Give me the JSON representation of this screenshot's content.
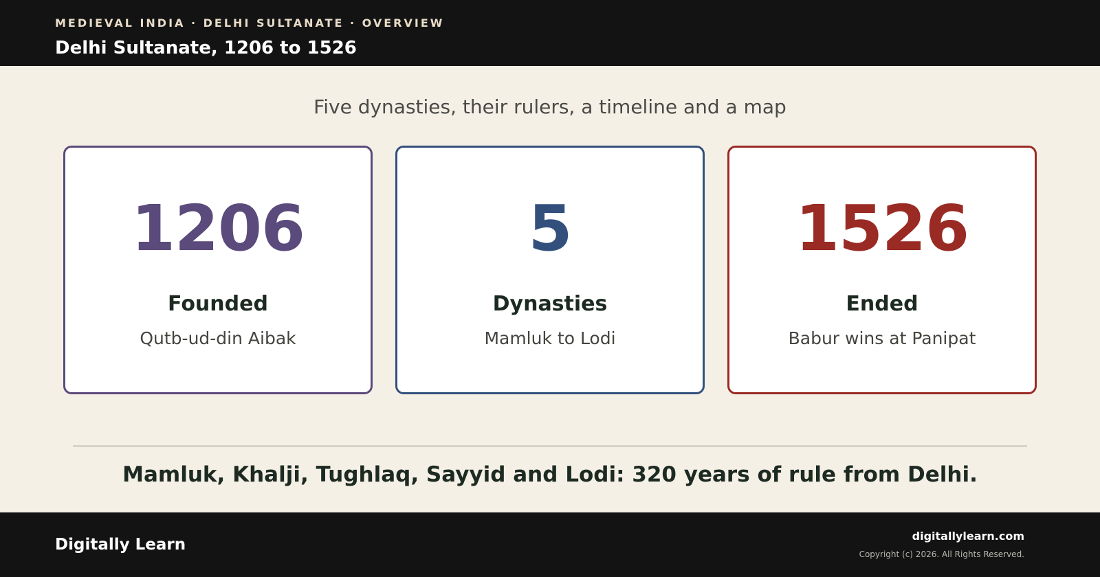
{
  "header": {
    "eyebrow": "MEDIEVAL INDIA · DELHI SULTANATE · OVERVIEW",
    "title": "Delhi Sultanate, 1206 to 1526"
  },
  "main": {
    "subtitle": "Five dynasties, their rulers, a timeline and a map",
    "cards": [
      {
        "number": "1206",
        "label": "Founded",
        "sub": "Qutb-ud-din Aibak",
        "color": "#5b4a7c"
      },
      {
        "number": "5",
        "label": "Dynasties",
        "sub": "Mamluk to Lodi",
        "color": "#33507c"
      },
      {
        "number": "1526",
        "label": "Ended",
        "sub": "Babur wins at Panipat",
        "color": "#9a2a24"
      }
    ],
    "summary": "Mamluk, Khalji, Tughlaq, Sayyid and Lodi: 320 years of rule from Delhi."
  },
  "footer": {
    "brand": "Digitally Learn",
    "site": "digitallylearn.com",
    "copyright": "Copyright (c) 2026. All Rights Reserved."
  },
  "colors": {
    "background": "#f5f0e6",
    "bars": "#131313"
  }
}
